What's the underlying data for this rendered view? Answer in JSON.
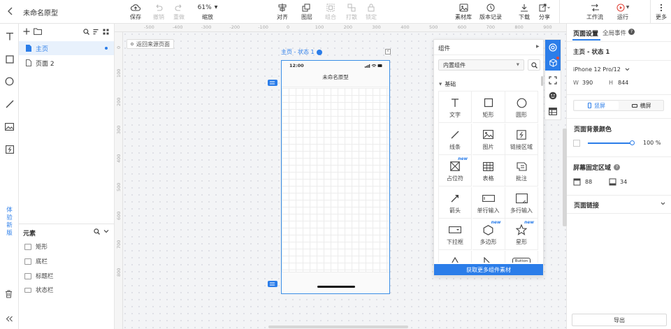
{
  "app": {
    "title": "未命名原型"
  },
  "toolbar": {
    "save": "保存",
    "undo": "撤销",
    "redo": "重做",
    "zoom_value": "61%",
    "zoom_label": "缩放",
    "align": "对齐",
    "layer": "图层",
    "group": "组合",
    "ungroup": "打散",
    "lock": "锁定",
    "material": "素材库",
    "history": "版本记录",
    "download": "下载",
    "share": "分享",
    "workflow": "工作流",
    "run": "运行",
    "more": "更多"
  },
  "tools": [
    "text-tool",
    "rectangle-tool",
    "circle-tool",
    "line-tool",
    "image-tool",
    "link-area-tool"
  ],
  "experience_badge": [
    "体",
    "验",
    "新",
    "版"
  ],
  "pages": {
    "items": [
      {
        "label": "主页",
        "active": true
      },
      {
        "label": "页面 2",
        "active": false
      }
    ]
  },
  "elements": {
    "title": "元素",
    "items": [
      "矩形",
      "底栏",
      "标题栏",
      "状态栏"
    ]
  },
  "canvas": {
    "back_button": "返回来源页面",
    "frame_title": "主页 - 状态 1",
    "ruler_top": [
      "-500",
      "-400",
      "-300",
      "-200",
      "-100",
      "0",
      "100",
      "200",
      "300",
      "400",
      "500",
      "600",
      "700",
      "800",
      "900",
      "1000"
    ],
    "ruler_left": [
      "0",
      "100",
      "200",
      "300",
      "400",
      "500",
      "600",
      "700",
      "800"
    ]
  },
  "phone": {
    "time": "12:00",
    "title": "未命名原型"
  },
  "components": {
    "header": "组件",
    "library_select": "内置组件",
    "category": "基础",
    "items": [
      {
        "label": "文字",
        "icon": "text-icon",
        "new": false
      },
      {
        "label": "矩形",
        "icon": "rectangle-icon",
        "new": false
      },
      {
        "label": "圆形",
        "icon": "circle-icon",
        "new": false
      },
      {
        "label": "线条",
        "icon": "line-icon",
        "new": false
      },
      {
        "label": "图片",
        "icon": "image-icon",
        "new": false
      },
      {
        "label": "链接区域",
        "icon": "link-area-icon",
        "new": false
      },
      {
        "label": "占位符",
        "icon": "placeholder-icon",
        "new": true
      },
      {
        "label": "表格",
        "icon": "table-icon",
        "new": false
      },
      {
        "label": "批注",
        "icon": "note-icon",
        "new": false
      },
      {
        "label": "箭头",
        "icon": "arrow-icon",
        "new": false
      },
      {
        "label": "单行输入",
        "icon": "single-input-icon",
        "new": false
      },
      {
        "label": "多行输入",
        "icon": "multi-input-icon",
        "new": false
      },
      {
        "label": "下拉框",
        "icon": "dropdown-icon",
        "new": false
      },
      {
        "label": "多边形",
        "icon": "polygon-icon",
        "new": true
      },
      {
        "label": "星形",
        "icon": "star-icon",
        "new": true
      },
      {
        "label": "",
        "icon": "triangle-icon",
        "new": false
      },
      {
        "label": "",
        "icon": "right-triangle-icon",
        "new": false
      },
      {
        "label": "",
        "icon": "button-icon",
        "new": false
      }
    ],
    "button_text": "Button",
    "more_button": "获取更多组件素材",
    "new_tag": "new"
  },
  "settings": {
    "tab_page": "页面设置",
    "tab_events": "全局事件",
    "page_name": "主页 - 状态 1",
    "device": "iPhone 12 Pro/12",
    "w_label": "W",
    "w_value": "390",
    "h_label": "H",
    "h_value": "844",
    "portrait": "竖屏",
    "landscape": "横屏",
    "bg_color_label": "页面背景颜色",
    "bg_opacity": "100 %",
    "fixed_area_label": "屏幕固定区域",
    "fixed_top": "88",
    "fixed_bottom": "34",
    "page_link_label": "页面链接",
    "export": "导出"
  },
  "colors": {
    "accent": "#2b7de9",
    "border": "#e5e5e5",
    "canvas_bg": "#f3f4f6"
  }
}
